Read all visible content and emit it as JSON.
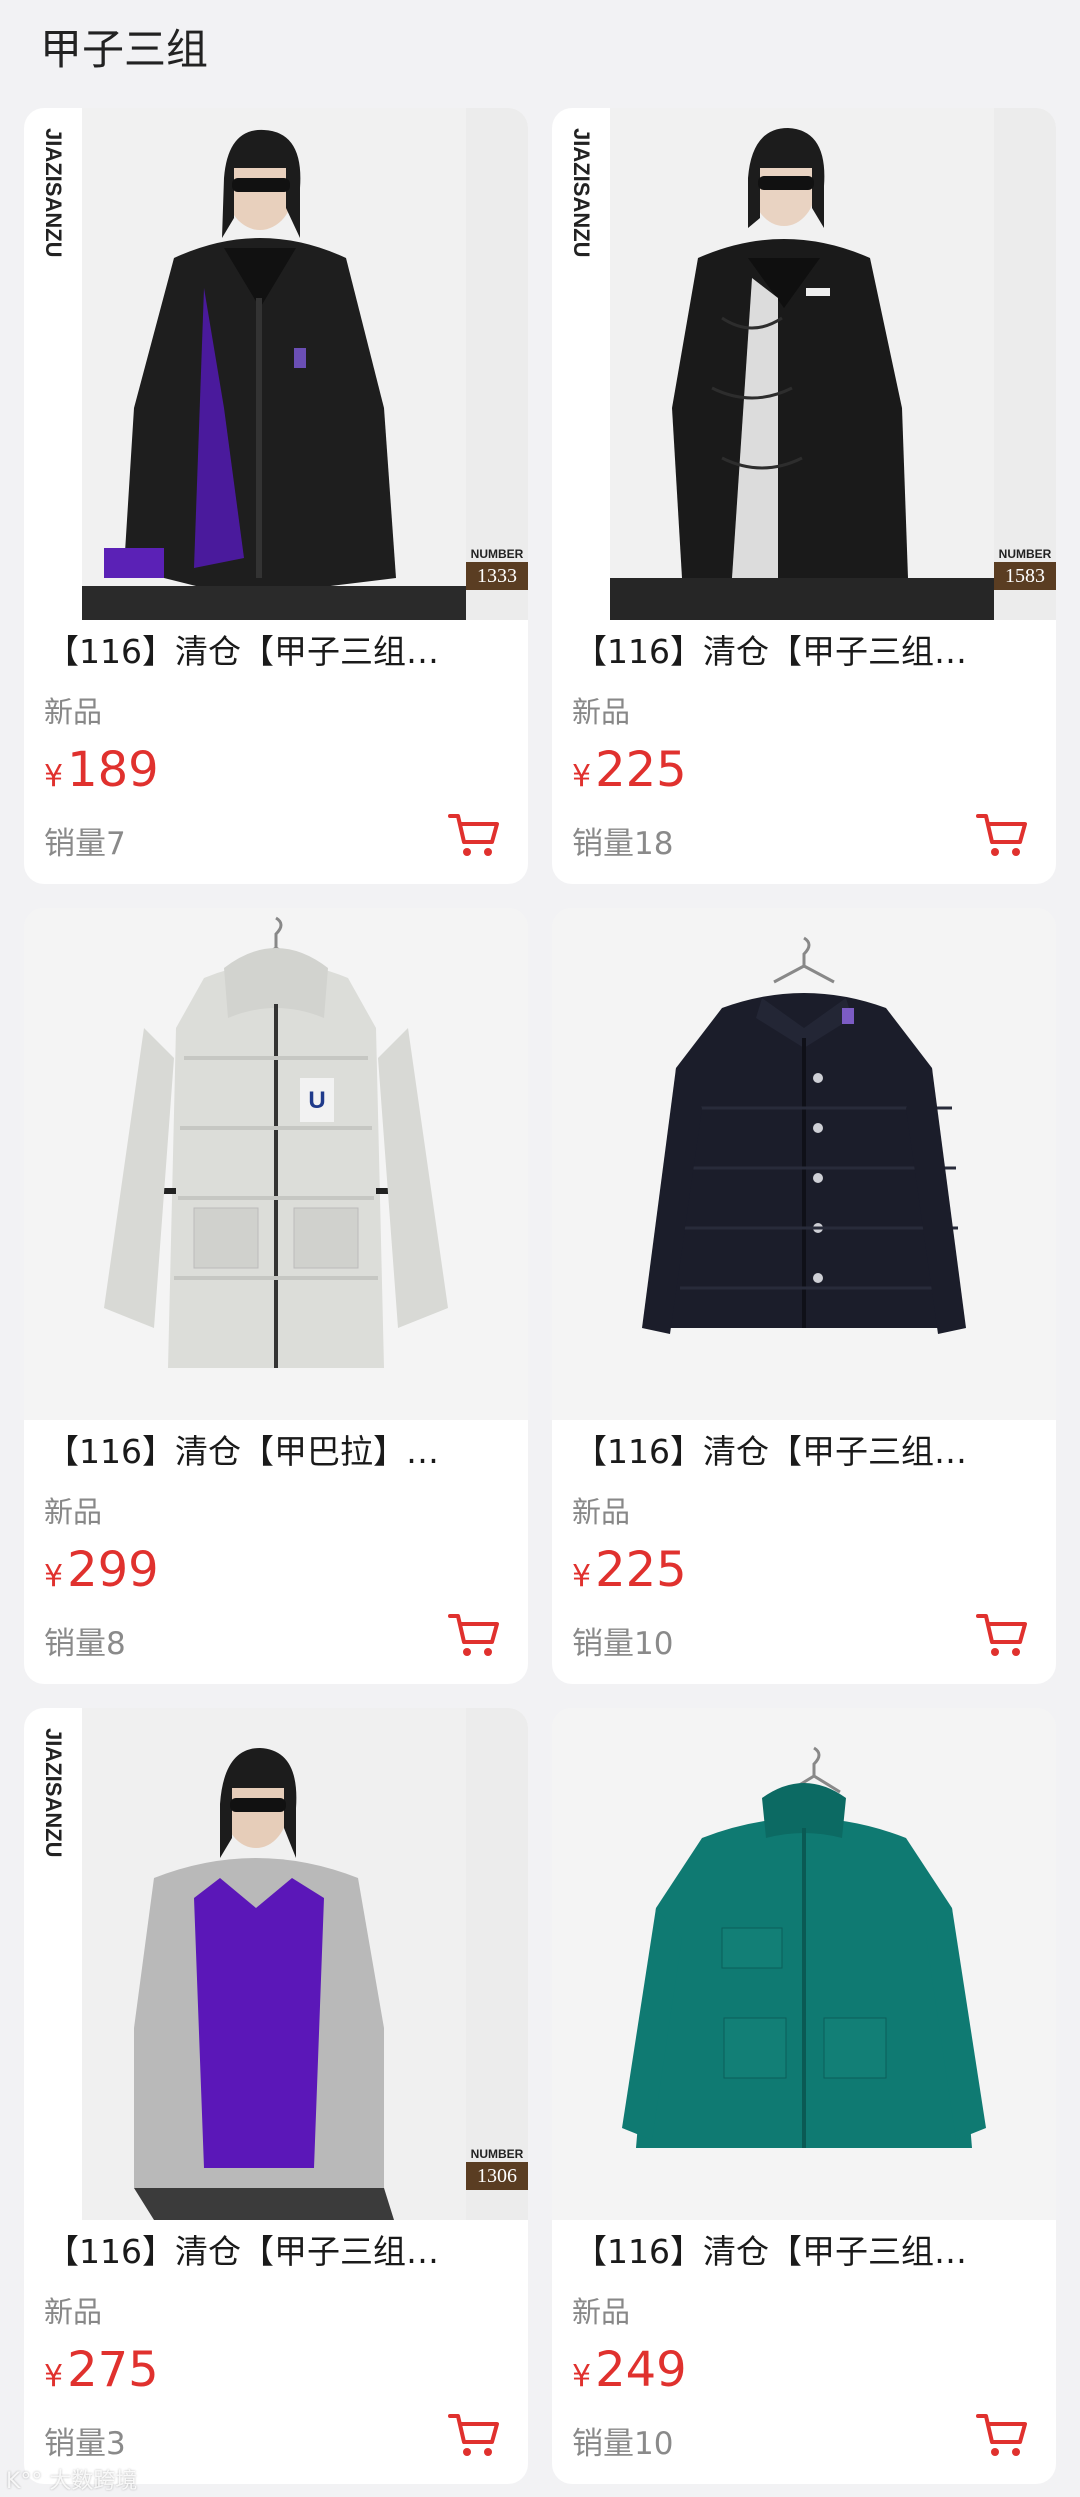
{
  "header": {
    "title": "甲子三组"
  },
  "products": [
    {
      "title": "【116】清仓【甲子三组…",
      "tag": "新品",
      "price_symbol": "¥",
      "price": "189",
      "sales": "销量7",
      "brand": "JIAZISANZU",
      "number_label": "NUMBER",
      "number": "1333",
      "image": "model-black-puffer"
    },
    {
      "title": "【116】清仓【甲子三组…",
      "tag": "新品",
      "price_symbol": "¥",
      "price": "225",
      "sales": "销量18",
      "brand": "JIAZISANZU",
      "number_label": "NUMBER",
      "number": "1583",
      "image": "model-black-quilted-jacket"
    },
    {
      "title": "【116】清仓【甲巴拉】…",
      "tag": "新品",
      "price_symbol": "¥",
      "price": "299",
      "sales": "销量8",
      "image": "hanging-white-hooded-down-coat"
    },
    {
      "title": "【116】清仓【甲子三组…",
      "tag": "新品",
      "price_symbol": "¥",
      "price": "225",
      "sales": "销量10",
      "image": "hanging-navy-quilted-jacket"
    },
    {
      "title": "【116】清仓【甲子三组…",
      "tag": "新品",
      "price_symbol": "¥",
      "price": "275",
      "sales": "销量3",
      "brand": "JIAZISANZU",
      "number_label": "NUMBER",
      "number": "1306",
      "image": "model-grey-coat-purple-sweater"
    },
    {
      "title": "【116】清仓【甲子三组…",
      "tag": "新品",
      "price_symbol": "¥",
      "price": "249",
      "sales": "销量10",
      "image": "hanging-teal-down-jacket"
    }
  ],
  "watermark": "K°° 大数跨境",
  "colors": {
    "price": "#e0312e",
    "background": "#f2f2f4",
    "badge": "#5a3d22"
  }
}
